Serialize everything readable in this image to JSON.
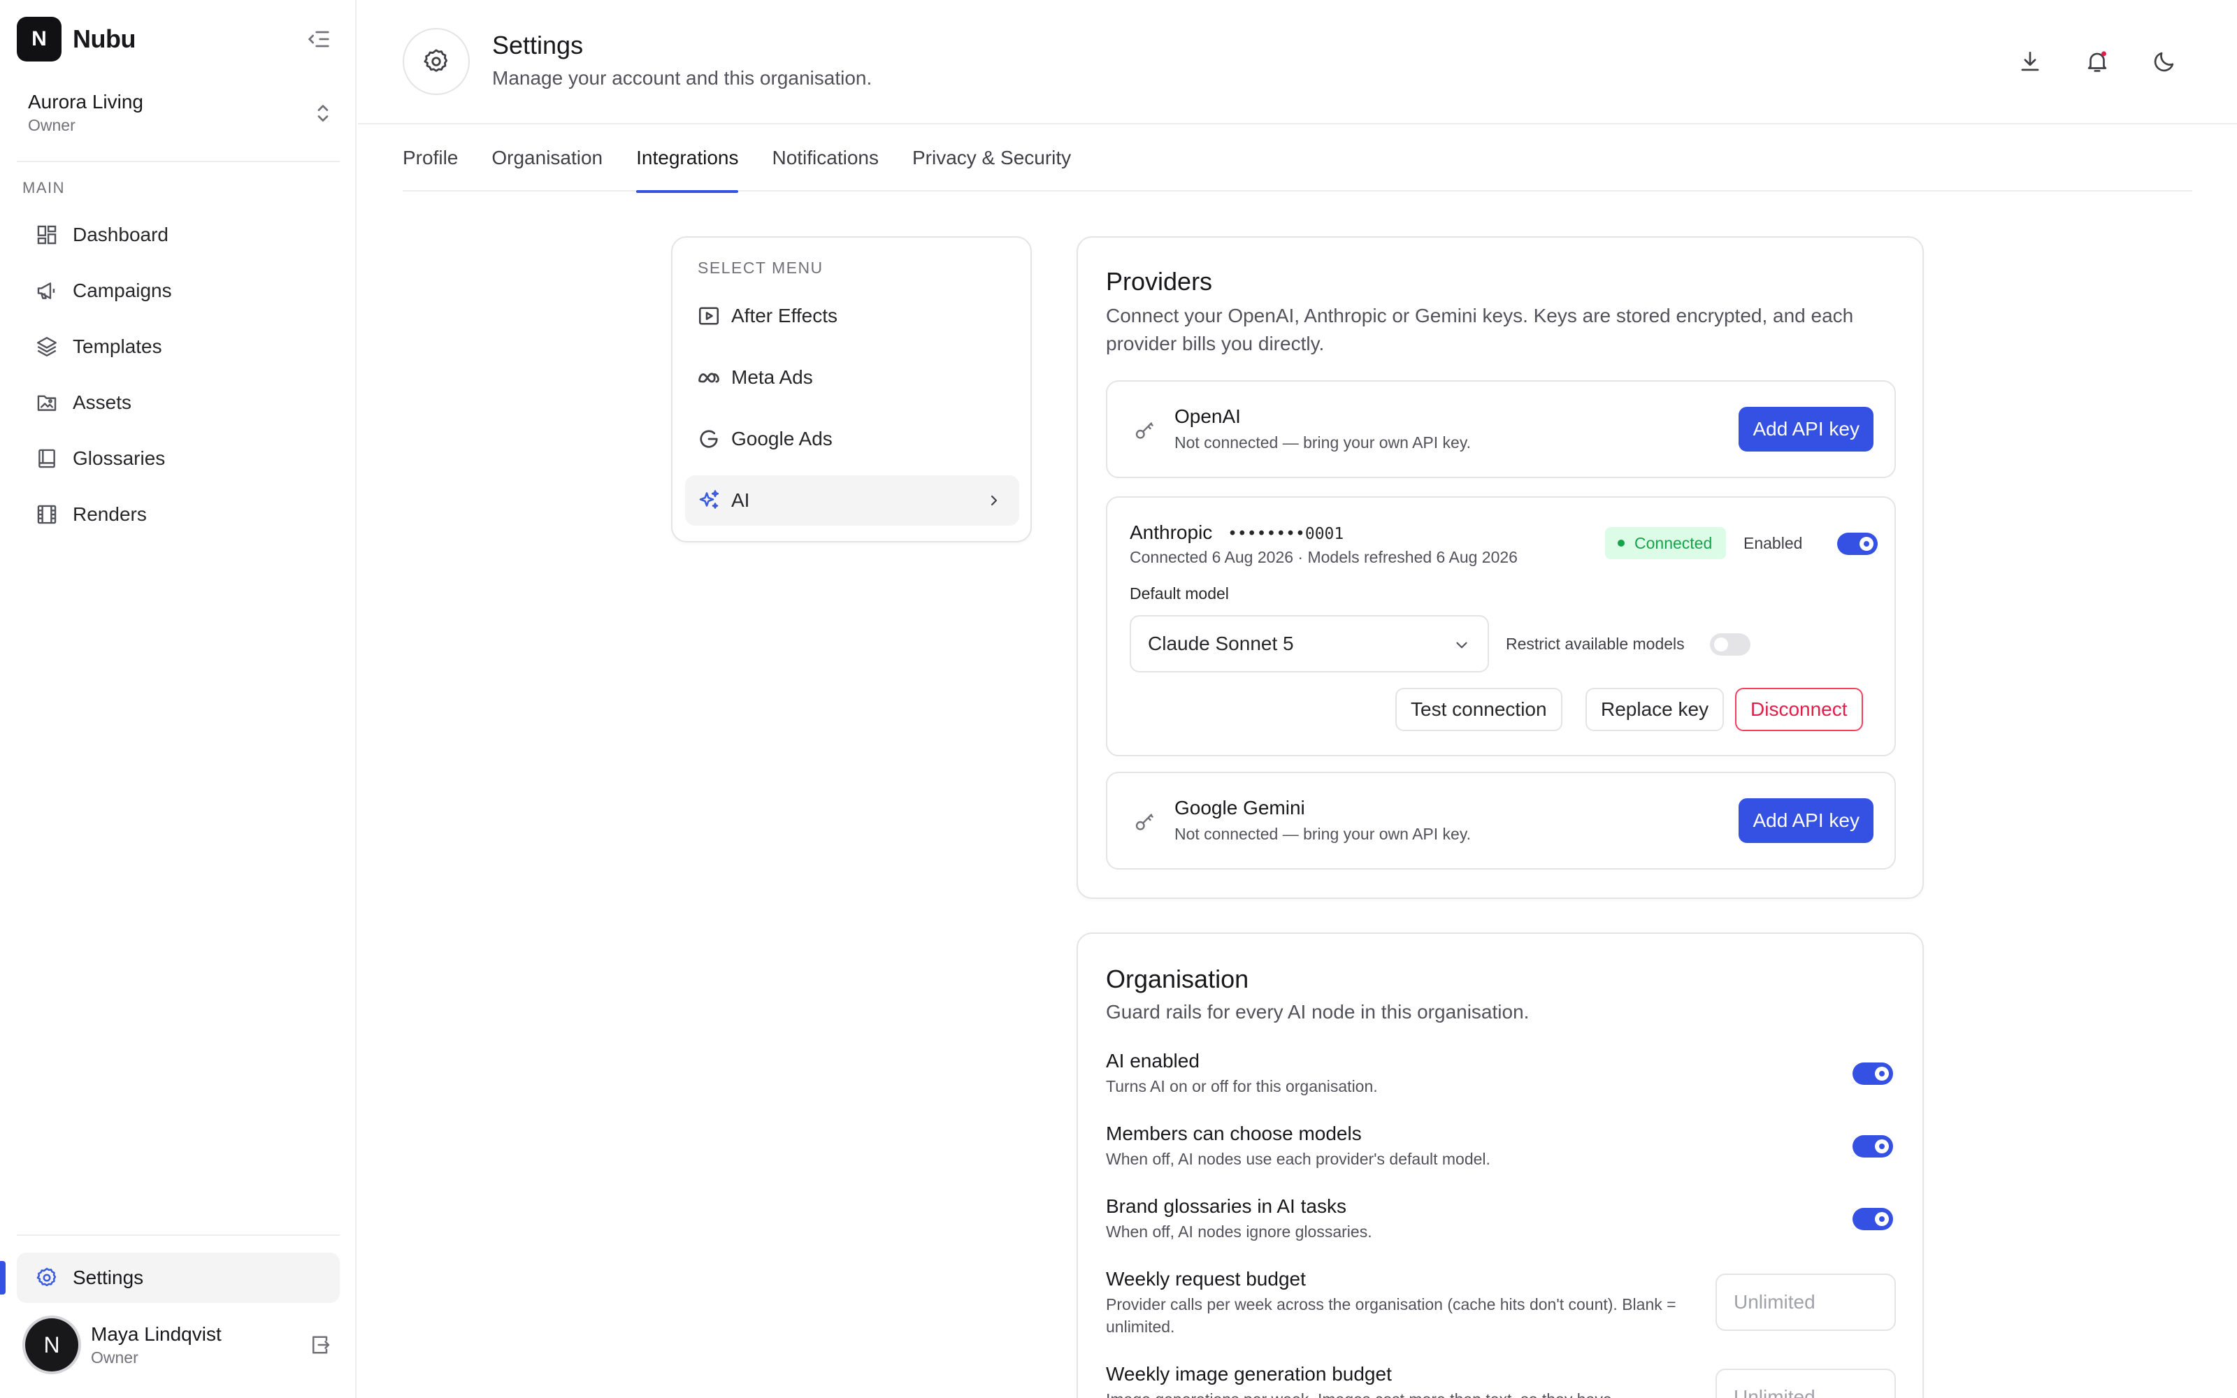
{
  "app": {
    "logo_letter": "N",
    "name": "Nubu"
  },
  "org": {
    "name": "Aurora Living",
    "role": "Owner"
  },
  "sidebar": {
    "section_label": "MAIN",
    "items": [
      {
        "label": "Dashboard",
        "icon": "dashboard-icon"
      },
      {
        "label": "Campaigns",
        "icon": "megaphone-icon"
      },
      {
        "label": "Templates",
        "icon": "layers-icon"
      },
      {
        "label": "Assets",
        "icon": "image-folder-icon"
      },
      {
        "label": "Glossaries",
        "icon": "book-icon"
      },
      {
        "label": "Renders",
        "icon": "film-icon"
      }
    ],
    "settings_label": "Settings"
  },
  "user": {
    "initial": "N",
    "name": "Maya Lindqvist",
    "role": "Owner"
  },
  "header": {
    "title": "Settings",
    "subtitle": "Manage your account and this organisation."
  },
  "tabs": [
    "Profile",
    "Organisation",
    "Integrations",
    "Notifications",
    "Privacy & Security"
  ],
  "active_tab": "Integrations",
  "select_menu": {
    "label": "SELECT MENU",
    "items": [
      {
        "label": "After Effects",
        "icon": "play-square-icon"
      },
      {
        "label": "Meta Ads",
        "icon": "meta-icon"
      },
      {
        "label": "Google Ads",
        "icon": "google-icon"
      },
      {
        "label": "AI",
        "icon": "sparkles-icon"
      }
    ],
    "active": "AI"
  },
  "providers": {
    "title": "Providers",
    "description": "Connect your OpenAI, Anthropic or Gemini keys. Keys are stored encrypted, and each provider bills you directly.",
    "openai": {
      "name": "OpenAI",
      "status": "Not connected — bring your own API key.",
      "button": "Add API key"
    },
    "anthropic": {
      "name": "Anthropic",
      "key_masked": "••••••••0001",
      "meta": "Connected 6 Aug 2026 · Models refreshed 6 Aug 2026",
      "badge": "Connected",
      "enabled_label": "Enabled",
      "enabled": true,
      "default_model_label": "Default model",
      "default_model": "Claude Sonnet 5",
      "restrict_label": "Restrict available models",
      "restrict": false,
      "test_button": "Test connection",
      "replace_button": "Replace key",
      "disconnect_button": "Disconnect"
    },
    "gemini": {
      "name": "Google Gemini",
      "status": "Not connected — bring your own API key.",
      "button": "Add API key"
    }
  },
  "organisation": {
    "title": "Organisation",
    "description": "Guard rails for every AI node in this organisation.",
    "settings": [
      {
        "title": "AI enabled",
        "desc": "Turns AI on or off for this organisation.",
        "on": true
      },
      {
        "title": "Members can choose models",
        "desc": "When off, AI nodes use each provider's default model.",
        "on": true
      },
      {
        "title": "Brand glossaries in AI tasks",
        "desc": "When off, AI nodes ignore glossaries.",
        "on": true
      }
    ],
    "budgets": [
      {
        "title": "Weekly request budget",
        "desc": "Provider calls per week across the organisation (cache hits don't count). Blank = unlimited.",
        "placeholder": "Unlimited"
      },
      {
        "title": "Weekly image generation budget",
        "desc": "Image generations per week. Images cost more than text, so they have",
        "placeholder": "Unlimited"
      }
    ]
  },
  "colors": {
    "accent": "#3451e4",
    "success": "#16a34a",
    "danger": "#e11d48"
  }
}
